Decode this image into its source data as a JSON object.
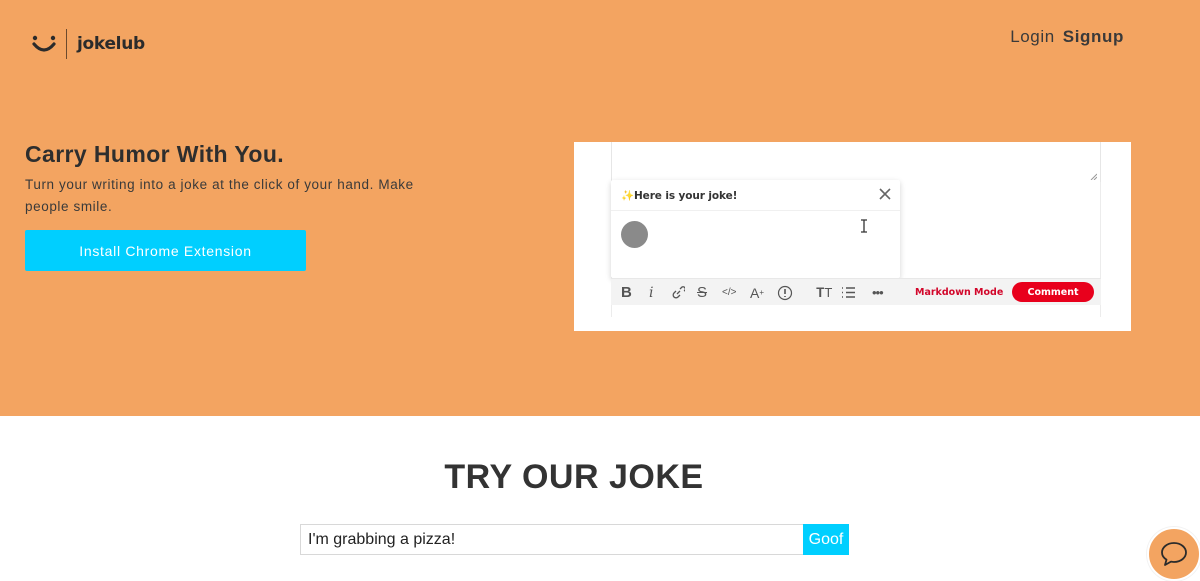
{
  "brand": {
    "name": "jokelub"
  },
  "nav": {
    "login_label": "Login",
    "signup_label": "Signup"
  },
  "hero": {
    "headline": "Carry Humor With You.",
    "subheadline": "Turn your writing into a joke at the click of your hand. Make people smile.",
    "cta_label": "Install Chrome Extension"
  },
  "demo": {
    "popup_title": "Here is your joke!",
    "markdown_mode_label": "Markdown Mode",
    "comment_label": "Comment"
  },
  "try": {
    "title": "TRY OUR JOKE",
    "input_value": "I'm grabbing a pizza!",
    "submit_label": "Goof"
  },
  "colors": {
    "hero_bg": "#f3a461",
    "accent": "#00cfff",
    "comment_red": "#e8001c"
  },
  "icons": {
    "logo": "smile-icon",
    "chat": "chat-bubble-icon",
    "close": "close-icon"
  }
}
